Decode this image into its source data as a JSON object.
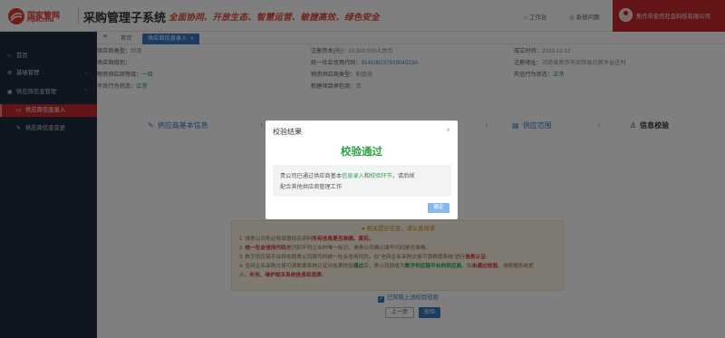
{
  "header": {
    "logo_cn": "国家管网",
    "logo_en": "PipeChina",
    "system_title": "采购管理子系统",
    "slogan": "全面协同、开放生态、智慧运营、敏捷高效、绿色安全",
    "workbench_label": "工作台",
    "map_label": "系统问题",
    "user_name": "焦作市安信社会科技有限公司",
    "brand_color": "#c8262e"
  },
  "sidebar": {
    "items": [
      {
        "label": "首页",
        "icon": "home-icon"
      },
      {
        "label": "基础管理",
        "icon": "gear-icon"
      },
      {
        "label": "供应商信息管理",
        "icon": "folder-icon"
      },
      {
        "label": "供应商信息录入",
        "icon": "folder-open-icon"
      },
      {
        "label": "供应商信息变更",
        "icon": "edit-icon"
      }
    ]
  },
  "tabs": {
    "home": "首页",
    "active": "供应商信息录入"
  },
  "info": {
    "r1c1_label": "供应商类型：",
    "r1c1_val": "检测",
    "r1c2_label": "注册资本(元)：",
    "r1c2_val": "10,500,000人民币",
    "r1c3_label": "成立时间：",
    "r1c3_val": "2023-12-12",
    "r2c1_label": "供应商级别：",
    "r2c2_label": "统一社会信用代码：",
    "r2c2_val": "91410823791904523A",
    "r2c3_label": "注册地址：",
    "r2c3_val": "河南省焦作市武陟县北郭乡益庄村",
    "r3c1_label": "物资供应商等级：",
    "r3c1_val": "一级",
    "r3c2_label": "物资供应商类型：",
    "r3c2_val": "制造商",
    "r3c3_label": "失信行为状态：",
    "r3c3_val": "正常",
    "r4c1_label": "不良行为状态：",
    "r4c1_val": "正常",
    "r4c2_label": "新建项目承包商：",
    "r4c2_val": "否"
  },
  "steps": {
    "s1": "供应商基本信息",
    "s2": "供应范围",
    "s3": "信息校验"
  },
  "notice": {
    "title": "相关提示信息，请认真阅读",
    "l1a": "1. 请贵公司务必将填报相关资料",
    "l1b": "所有信息是否准确、真实。",
    "l2a": "2. ",
    "l2b": "统一社会信用代码",
    "l2c": "是识别不同企业的唯一标识，请贵公司确认填写代码是否准确。",
    "l3a": "3. 数字供应链平台将依据贵公司填写的统一社会信用代码，在\"全网企业采购交易可源数据系统\"进行",
    "l3b": "信息认证",
    "l3c": "。",
    "l4a": "4. 全网企业采购交易可源数据系统认证对结果校验",
    "l4b": "通过",
    "l4c": "后，贵公司即成为",
    "l4d": "数字供应链平台的供应商",
    "l4e": "。如",
    "l4f": "未通过校验",
    "l4g": "，请根据系统提",
    "l5a": "示，",
    "l5b": "补充、维护相关系统信息和资质",
    "l5c": "。"
  },
  "agree_label": "已知晓上述校验规则",
  "buttons": {
    "prev": "上一步",
    "verify": "校验"
  },
  "modal": {
    "title": "校验结果",
    "big_text": "校验通过",
    "msg_a": "贵公司已通过供应商基本",
    "msg_b": "信息录入",
    "msg_c": "和",
    "msg_d": "校验环节",
    "msg_e": "，请后续",
    "msg_line2": "配合其他供应商管理工作",
    "ok_label": "确定"
  }
}
